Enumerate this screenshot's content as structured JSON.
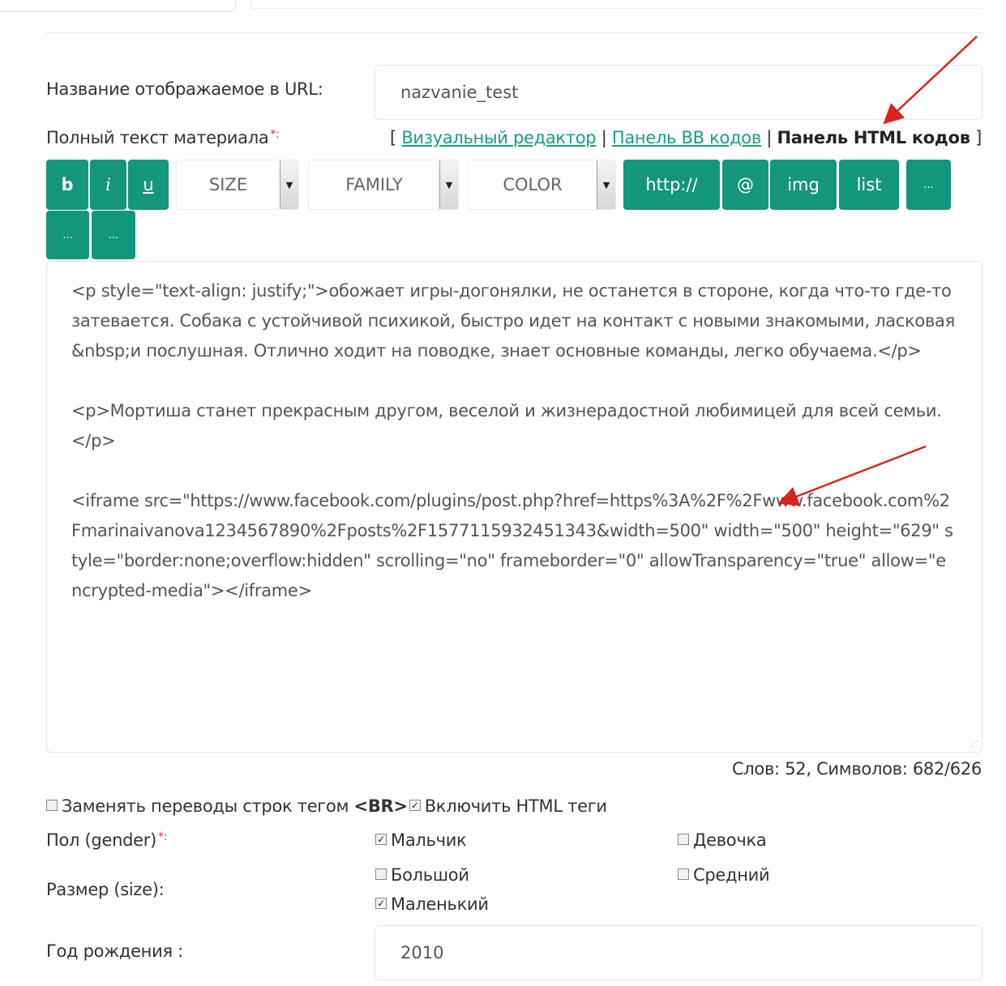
{
  "url_label": "Название отображаемое в URL:",
  "url_value": "nazvanie_test",
  "fulltext_label": "Полный текст материала",
  "required_mark": "*:",
  "editor_modes": {
    "open": "[",
    "visual": "Визуальный редактор",
    "sep1": "|",
    "bb": "Панель BB кодов",
    "sep2": "|",
    "html": "Панель HTML кодов",
    "close": "]"
  },
  "toolbar": {
    "bold": "b",
    "italic": "i",
    "underline": "u",
    "size": "SIZE",
    "family": "FAMILY",
    "color": "COLOR",
    "link": "http://",
    "email": "@",
    "img": "img",
    "list": "list",
    "more1": "...",
    "more2": "...",
    "more3": "..."
  },
  "editor_text": "<p style=\"text-align: justify;\">обожает игры-догонялки, не останется в стороне, когда что-то где-то затевается. Собака с устойчивой психикой, быстро идет на контакт с новыми знакомыми, ласковая&nbsp;и послушная. Отлично ходит на поводке, знает основные команды, легко обучаема.</p>\n\n<p>Мортиша станет прекрасным другом, веселой и жизнерадостной любимицей для всей семьи.</p>\n\n<iframe src=\"https://www.facebook.com/plugins/post.php?href=https%3A%2F%2Fwww.facebook.com%2Fmarinaivanova1234567890%2Fposts%2F1577115932451343&width=500\" width=\"500\" height=\"629\" style=\"border:none;overflow:hidden\" scrolling=\"no\" frameborder=\"0\" allowTransparency=\"true\" allow=\"encrypted-media\"></iframe>",
  "counter": "Слов: 52, Символов: 682/626",
  "replace_br_label": "Заменять переводы строк тегом",
  "replace_br_tag": "<BR>",
  "replace_br_checked": false,
  "enable_html_label": "Включить HTML теги",
  "enable_html_checked": true,
  "gender_label": "Пол (gender)",
  "gender_options": {
    "boy": "Мальчик",
    "girl": "Девочка"
  },
  "size_label": "Размер (size):",
  "size_options": {
    "big": "Большой",
    "medium": "Средний",
    "small": "Маленький"
  },
  "birth_label": "Год рождения :",
  "birth_value": "2010",
  "colors": {
    "accent": "#14967c",
    "link": "#159e84",
    "annotation_arrow": "#d9231d"
  }
}
